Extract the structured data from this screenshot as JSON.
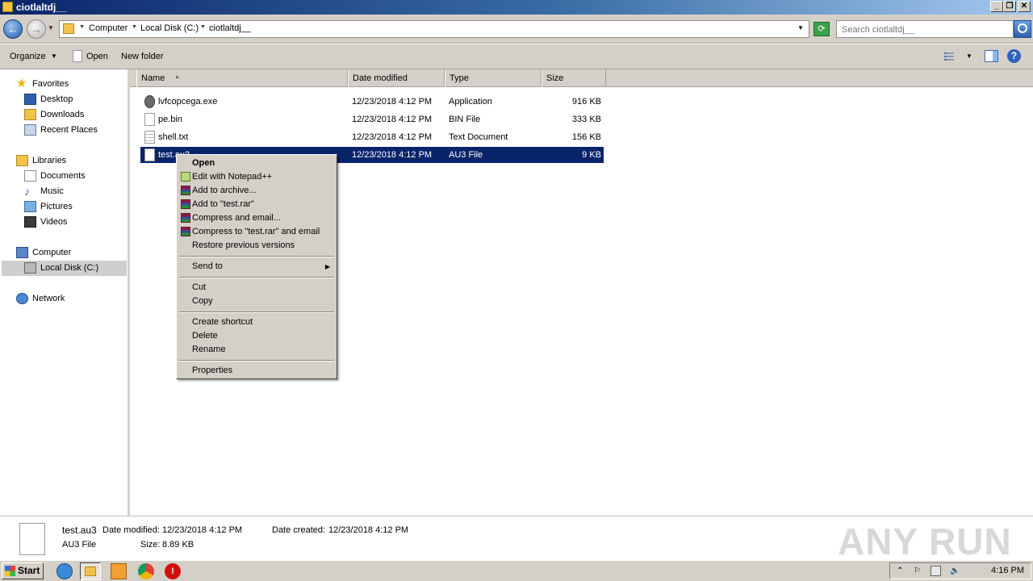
{
  "window": {
    "title": "ciotlaltdj__"
  },
  "address": {
    "crumbs": [
      "Computer",
      "Local Disk (C:)",
      "ciotlaltdj__"
    ],
    "search_placeholder": "Search ciotlaltdj__"
  },
  "toolbar": {
    "organize": "Organize",
    "open": "Open",
    "new_folder": "New folder"
  },
  "nav": {
    "favorites": "Favorites",
    "desktop": "Desktop",
    "downloads": "Downloads",
    "recent_places": "Recent Places",
    "libraries": "Libraries",
    "documents": "Documents",
    "music": "Music",
    "pictures": "Pictures",
    "videos": "Videos",
    "computer": "Computer",
    "local_disk": "Local Disk (C:)",
    "network": "Network"
  },
  "columns": {
    "name": "Name",
    "date": "Date modified",
    "type": "Type",
    "size": "Size"
  },
  "files": [
    {
      "name": "lvfcopcega.exe",
      "date": "12/23/2018 4:12 PM",
      "type": "Application",
      "size": "916 KB",
      "icon": "autoit-icon"
    },
    {
      "name": "pe.bin",
      "date": "12/23/2018 4:12 PM",
      "type": "BIN File",
      "size": "333 KB",
      "icon": "file-icon"
    },
    {
      "name": "shell.txt",
      "date": "12/23/2018 4:12 PM",
      "type": "Text Document",
      "size": "156 KB",
      "icon": "text-file-icon"
    },
    {
      "name": "test.au3",
      "date": "12/23/2018 4:12 PM",
      "type": "AU3 File",
      "size": "9 KB",
      "icon": "file-icon"
    }
  ],
  "context_menu": {
    "open": "Open",
    "edit_notepad": "Edit with Notepad++",
    "add_archive": "Add to archive...",
    "add_rar": "Add to \"test.rar\"",
    "compress_email": "Compress and email...",
    "compress_rar_email": "Compress to \"test.rar\" and email",
    "restore": "Restore previous versions",
    "send_to": "Send to",
    "cut": "Cut",
    "copy": "Copy",
    "create_shortcut": "Create shortcut",
    "delete": "Delete",
    "rename": "Rename",
    "properties": "Properties"
  },
  "details": {
    "filename": "test.au3",
    "date_modified_label": "Date modified:",
    "date_modified": "12/23/2018 4:12 PM",
    "date_created_label": "Date created:",
    "date_created": "12/23/2018 4:12 PM",
    "type": "AU3 File",
    "size_label": "Size:",
    "size": "8.89 KB"
  },
  "watermark": "ANY RUN",
  "taskbar": {
    "start": "Start",
    "clock": "4:16 PM"
  },
  "colors": {
    "selection": "#0a246a",
    "titlebar": "#0a246a",
    "chrome": "#d4d0c8"
  }
}
